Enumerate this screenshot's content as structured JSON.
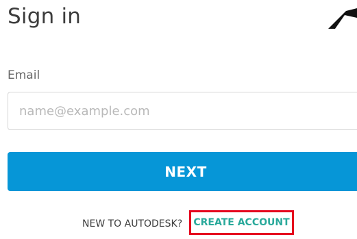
{
  "signin": {
    "title": "Sign in",
    "email_label": "Email",
    "email_placeholder": "name@example.com",
    "email_value": "",
    "next_label": "NEXT",
    "new_to_text": "NEW TO AUTODESK?",
    "create_account_label": "CREATE ACCOUNT"
  },
  "icons": {
    "logo": "autodesk-logo-icon"
  },
  "colors": {
    "primary_button": "#0696d7",
    "link": "#2aa99b",
    "highlight_box": "#e5001c"
  }
}
